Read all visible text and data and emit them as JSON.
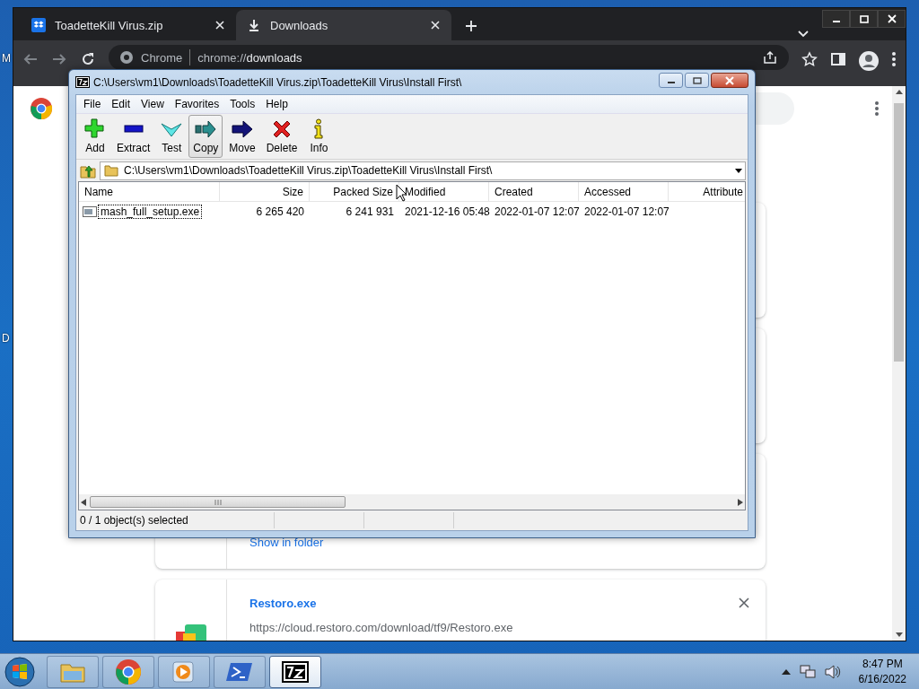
{
  "desktop": {
    "icon_labels": [
      "M",
      "D"
    ]
  },
  "browser": {
    "tabs": [
      {
        "title": "ToadetteKill Virus.zip",
        "selected": false
      },
      {
        "title": "Downloads",
        "selected": true
      }
    ],
    "address": {
      "chip": "Chrome",
      "url": "chrome://**downloads**"
    },
    "downloads": [
      {
        "kind": "covered"
      },
      {
        "kind": "covered"
      },
      {
        "kind": "link_only",
        "link": "Show in folder"
      },
      {
        "kind": "full",
        "file_name": "Restoro.exe",
        "url": "https://cloud.restoro.com/download/tf9/Restoro.exe"
      }
    ]
  },
  "archiver": {
    "title": "C:\\Users\\vm1\\Downloads\\ToadetteKill Virus.zip\\ToadetteKill Virus\\Install First\\",
    "menu": [
      "File",
      "Edit",
      "View",
      "Favorites",
      "Tools",
      "Help"
    ],
    "toolbar": [
      {
        "label": "Add",
        "kind": "add",
        "hovered": false
      },
      {
        "label": "Extract",
        "kind": "extract",
        "hovered": false
      },
      {
        "label": "Test",
        "kind": "test",
        "hovered": false
      },
      {
        "label": "Copy",
        "kind": "copy",
        "hovered": true
      },
      {
        "label": "Move",
        "kind": "move",
        "hovered": false
      },
      {
        "label": "Delete",
        "kind": "delete",
        "hovered": false
      },
      {
        "label": "Info",
        "kind": "info",
        "hovered": false
      }
    ],
    "path": "C:\\Users\\vm1\\Downloads\\ToadetteKill Virus.zip\\ToadetteKill Virus\\Install First\\",
    "columns": [
      "Name",
      "Size",
      "Packed Size",
      "Modified",
      "Created",
      "Accessed",
      "Attribute"
    ],
    "rows": [
      {
        "focused": true,
        "cells": [
          "mash_full_setup.exe",
          "6 265 420",
          "6 241 931",
          "2021-12-16 05:48",
          "2022-01-07 12:07",
          "2022-01-07 12:07"
        ]
      }
    ],
    "status": "0 / 1 object(s) selected"
  },
  "taskbar": {
    "apps": [
      {
        "kind": "explorer",
        "active": false
      },
      {
        "kind": "chrome",
        "active": false
      },
      {
        "kind": "media",
        "active": false
      },
      {
        "kind": "powershell",
        "active": false
      },
      {
        "kind": "sevenzip",
        "active": true
      }
    ],
    "time": "8:47 PM",
    "date": "6/16/2022"
  }
}
